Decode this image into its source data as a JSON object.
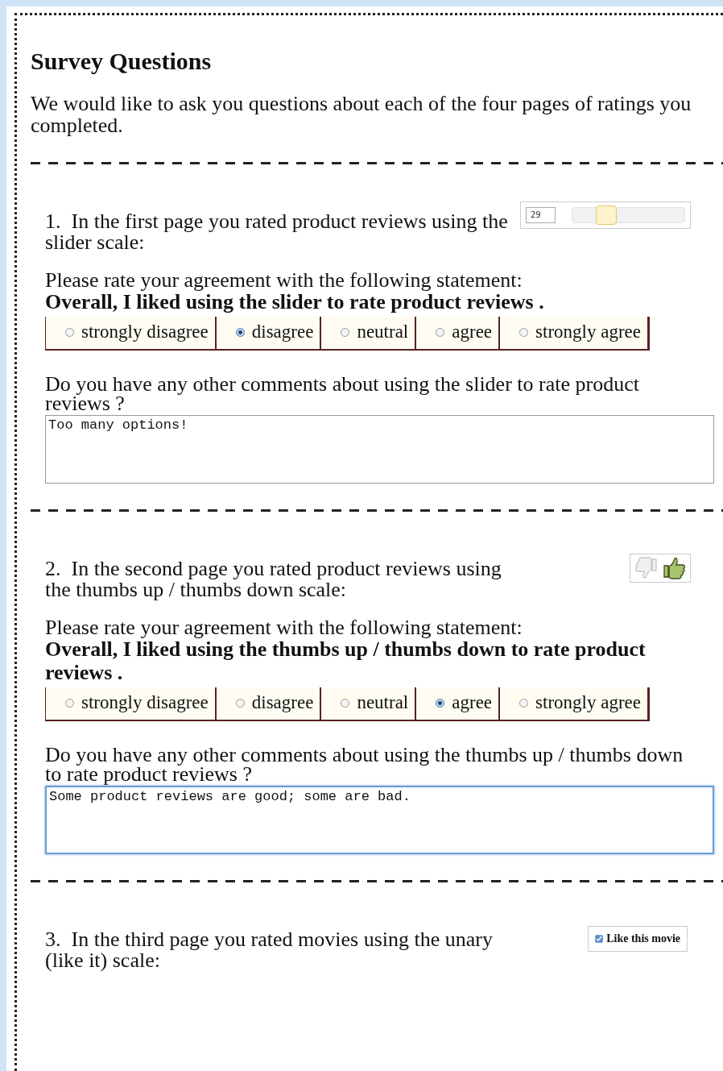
{
  "title": "Survey Questions",
  "intro": "We would like to ask you questions about each of the four pages of ratings you completed.",
  "questions": [
    {
      "number": "1.",
      "text": "In the first page you rated product reviews using the slider scale:",
      "example": {
        "kind": "slider",
        "value": "29",
        "level": 0.3
      },
      "prompt": "Please rate your agreement with the following statement:",
      "statement": "Overall, I liked using the slider to rate product reviews .",
      "options": [
        {
          "label": "strongly disagree",
          "selected": false
        },
        {
          "label": "disagree",
          "selected": true
        },
        {
          "label": "neutral",
          "selected": false
        },
        {
          "label": "agree",
          "selected": false
        },
        {
          "label": "strongly agree",
          "selected": false
        }
      ],
      "comment_prompt": "Do you have any other comments about using the slider to rate product reviews ?",
      "comment": "Too many options!",
      "comment_focused": false
    },
    {
      "number": "2.",
      "text": "In the second page you rated product reviews using the thumbs up / thumbs down scale:",
      "example": {
        "kind": "thumbs",
        "thumb_down": false,
        "thumb_up": true
      },
      "prompt": "Please rate your agreement with the following statement:",
      "statement": "Overall, I liked using the thumbs up / thumbs down to rate product reviews .",
      "options": [
        {
          "label": "strongly disagree",
          "selected": false
        },
        {
          "label": "disagree",
          "selected": false
        },
        {
          "label": "neutral",
          "selected": false
        },
        {
          "label": "agree",
          "selected": true
        },
        {
          "label": "strongly agree",
          "selected": false
        }
      ],
      "comment_prompt": "Do you have any other comments about using the thumbs up / thumbs down to rate product reviews ?",
      "comment": "Some product reviews are good; some are bad.",
      "comment_focused": true
    },
    {
      "number": "3.",
      "text": "In the third page you rated movies using the unary (like it) scale:",
      "example": {
        "kind": "checkbox",
        "label": "Like this movie",
        "checked": true
      }
    }
  ]
}
